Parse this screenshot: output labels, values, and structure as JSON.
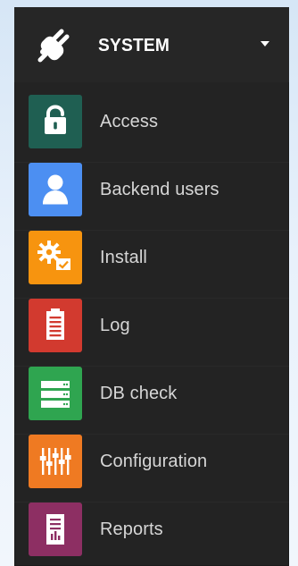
{
  "colors": {
    "panel_bg": "#232323",
    "header_text": "#ffffff",
    "label_text": "#d6d6d6"
  },
  "header": {
    "title": "SYSTEM",
    "icon": "plug-icon",
    "toggle_icon": "chevron-down-icon"
  },
  "menu": {
    "items": [
      {
        "label": "Access",
        "icon": "unlock-icon",
        "color": "#1f5f52"
      },
      {
        "label": "Backend users",
        "icon": "user-icon",
        "color": "#4c8ff2"
      },
      {
        "label": "Install",
        "icon": "gear-check-icon",
        "color": "#f7940f"
      },
      {
        "label": "Log",
        "icon": "clipboard-icon",
        "color": "#d23a2f"
      },
      {
        "label": "DB check",
        "icon": "server-icon",
        "color": "#2fa550"
      },
      {
        "label": "Configuration",
        "icon": "sliders-icon",
        "color": "#ef7a22"
      },
      {
        "label": "Reports",
        "icon": "report-chart-icon",
        "color": "#8d2f63"
      }
    ]
  }
}
